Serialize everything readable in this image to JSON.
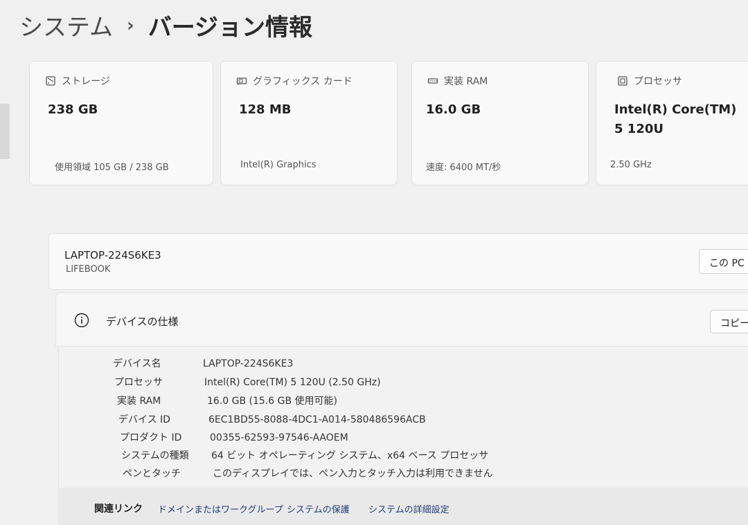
{
  "breadcrumb": {
    "parent": "システム",
    "separator": "›",
    "current": "バージョン情報"
  },
  "cards": [
    {
      "icon": "storage-icon",
      "label": "ストレージ",
      "value": "238 GB",
      "sub": "使用領域 105 GB / 238 GB"
    },
    {
      "icon": "graphics-card-icon",
      "label": "グラフィックス カード",
      "value": "128 MB",
      "sub": "Intel(R) Graphics"
    },
    {
      "icon": "ram-icon",
      "label": "実装 RAM",
      "value": "16.0 GB",
      "sub": "速度: 6400 MT/秒"
    },
    {
      "icon": "processor-icon",
      "label": "プロセッサ",
      "value": "Intel(R) Core(TM) 5 120U",
      "sub": "2.50 GHz"
    }
  ],
  "device": {
    "name": "LAPTOP-224S6KE3",
    "model": "LIFEBOOK",
    "rename_button": "この PC の名前を変更"
  },
  "specs": {
    "title": "デバイスの仕様",
    "copy_button": "コピー",
    "rows": [
      {
        "label": "デバイス名",
        "value": "LAPTOP-224S6KE3"
      },
      {
        "label": "プロセッサ",
        "value": "Intel(R) Core(TM) 5 120U (2.50 GHz)"
      },
      {
        "label": "実装 RAM",
        "value": "16.0 GB (15.6 GB 使用可能)"
      },
      {
        "label": "デバイス ID",
        "value": "6EC1BD55-8088-4DC1-A014-580486596ACB"
      },
      {
        "label": "プロダクト ID",
        "value": "00355-62593-97546-AAOEM"
      },
      {
        "label": "システムの種類",
        "value": "64 ビット オペレーティング システム、x64 ベース プロセッサ"
      },
      {
        "label": "ペンとタッチ",
        "value": "このディスプレイでは、ペン入力とタッチ入力は利用できません"
      }
    ]
  },
  "related": {
    "label": "関連リンク",
    "links": [
      "ドメインまたはワークグループ",
      "システムの保護",
      "システムの詳細設定"
    ]
  }
}
